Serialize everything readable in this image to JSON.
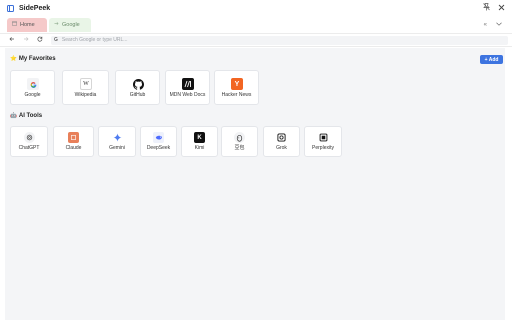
{
  "window": {
    "title": "SidePeek"
  },
  "tabs": [
    {
      "label": "Home",
      "active": true
    },
    {
      "label": "Google",
      "active": false
    }
  ],
  "address": {
    "placeholder": "Search Google or type URL..."
  },
  "favorites": {
    "title": "My Favorites",
    "add_label": "+ Add",
    "items": [
      {
        "label": "Google",
        "icon": "google-icon"
      },
      {
        "label": "Wikipedia",
        "icon": "wikipedia-icon"
      },
      {
        "label": "GitHub",
        "icon": "github-icon"
      },
      {
        "label": "MDN Web Docs",
        "icon": "mdn-icon"
      },
      {
        "label": "Hacker News",
        "icon": "hacker-news-icon"
      }
    ]
  },
  "ai_tools": {
    "title": "AI Tools",
    "items": [
      {
        "label": "ChatGPT",
        "icon": "chatgpt-icon"
      },
      {
        "label": "Claude",
        "icon": "claude-icon"
      },
      {
        "label": "Gemini",
        "icon": "gemini-icon"
      },
      {
        "label": "DeepSeek",
        "icon": "deepseek-icon"
      },
      {
        "label": "Kimi",
        "icon": "kimi-icon"
      },
      {
        "label": "豆包",
        "icon": "doubao-icon"
      },
      {
        "label": "Grok",
        "icon": "grok-icon"
      },
      {
        "label": "Perplexity",
        "icon": "perplexity-icon"
      }
    ]
  },
  "colors": {
    "accent": "#3d74e0",
    "home_tab": "#f5c9c9",
    "google_tab": "#e9f5e7",
    "hacker_news": "#f26522"
  }
}
